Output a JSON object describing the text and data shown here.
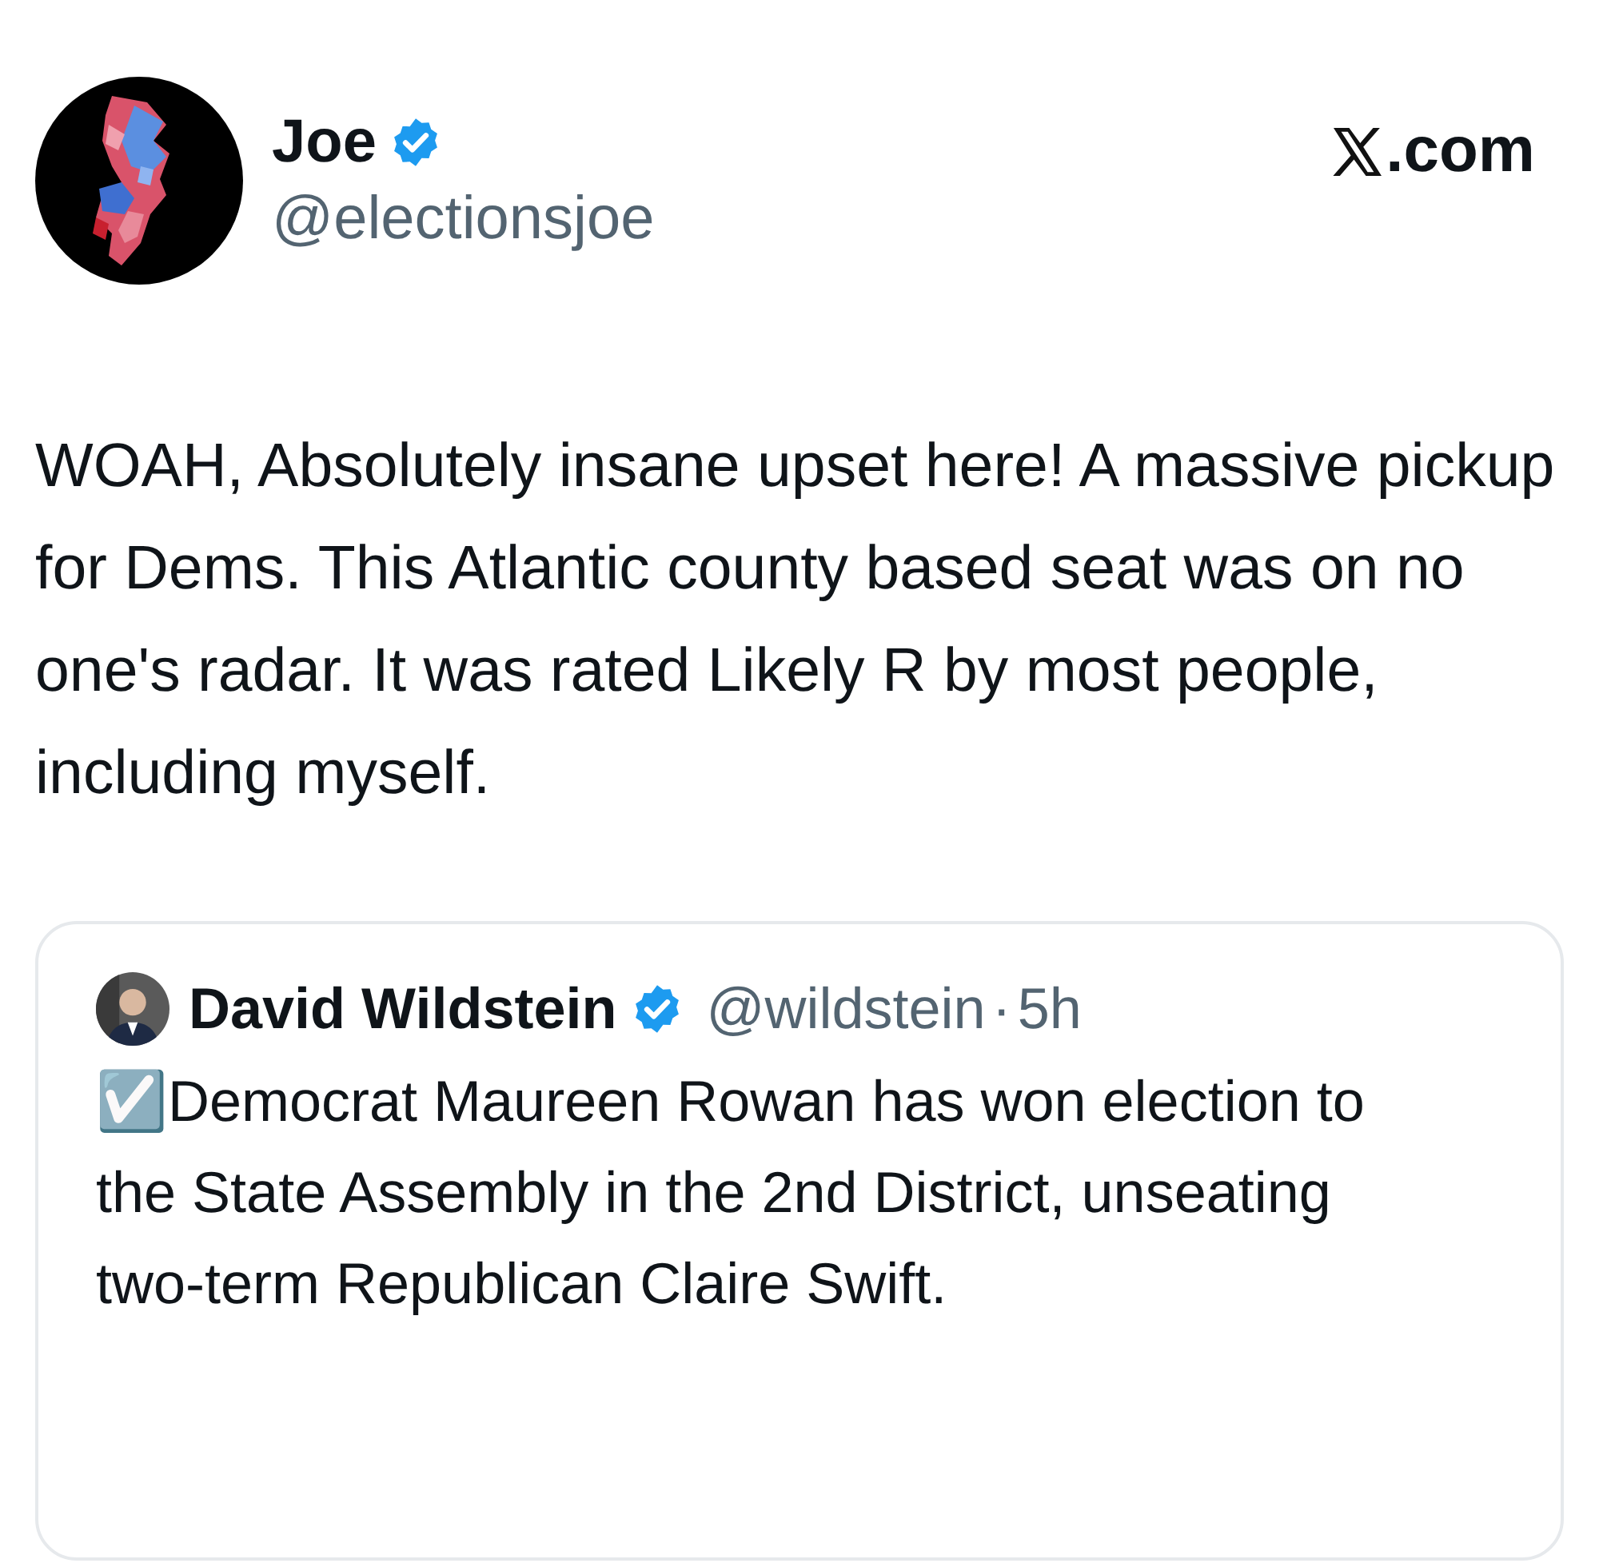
{
  "post": {
    "author": {
      "name": "Joe",
      "verified": true,
      "handle": "@electionsjoe"
    },
    "site": ".com",
    "text": "WOAH, Absolutely insane upset here! A massive pickup for Dems. This Atlantic county based seat was on no one's radar. It was rated Likely R by most people, including myself.",
    "quote": {
      "author": {
        "name": "David Wildstein",
        "verified": true,
        "handle": "@wildstein",
        "separator": "·",
        "time": "5h"
      },
      "text": "☑️Democrat Maureen Rowan has won election to the State Assembly in the 2nd District, unseating two-term Republican Claire Swift."
    }
  }
}
